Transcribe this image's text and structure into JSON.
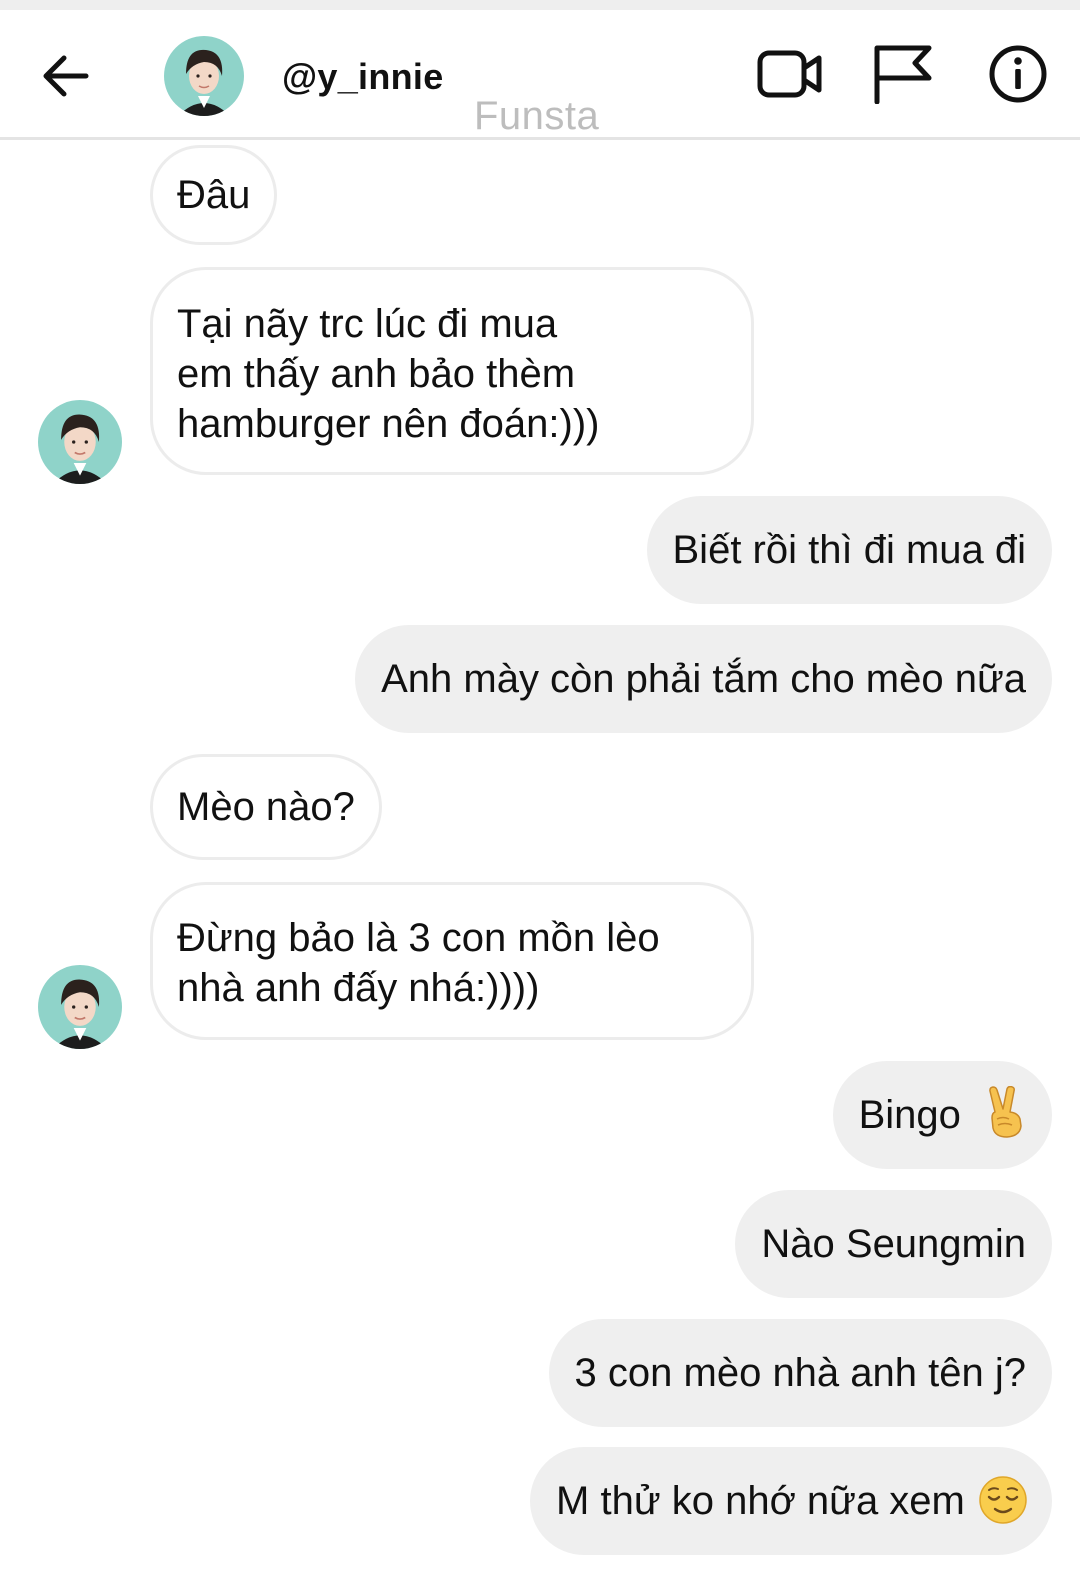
{
  "header": {
    "username": "@y_innie",
    "watermark": "Funsta",
    "icons": {
      "back": "arrow-left-icon",
      "video": "video-camera-icon",
      "flag": "flag-icon",
      "info": "info-icon"
    }
  },
  "messages": [
    {
      "direction": "incoming",
      "lines": [
        "Đâu"
      ]
    },
    {
      "direction": "incoming",
      "lines": [
        "Tại nãy trc lúc đi mua",
        "em thấy anh bảo thèm",
        "hamburger nên đoán:)))"
      ],
      "avatar": true
    },
    {
      "direction": "outgoing",
      "lines": [
        "Biết rồi thì đi mua đi"
      ]
    },
    {
      "direction": "outgoing",
      "lines": [
        "Anh mày còn phải tắm cho mèo nữa"
      ]
    },
    {
      "direction": "incoming",
      "lines": [
        "Mèo nào?"
      ]
    },
    {
      "direction": "incoming",
      "lines": [
        "Đừng bảo là 3 con mồn lèo",
        "nhà anh đấy nhá:))))"
      ],
      "avatar": true
    },
    {
      "direction": "outgoing",
      "lines": [
        "Bingo"
      ],
      "emoji": "victory-hand-emoji"
    },
    {
      "direction": "outgoing",
      "lines": [
        "Nào Seungmin"
      ]
    },
    {
      "direction": "outgoing",
      "lines": [
        "3 con mèo nhà anh tên j?"
      ]
    },
    {
      "direction": "outgoing",
      "lines": [
        "M thử ko nhớ nữa xem"
      ],
      "emoji": "relieved-face-emoji"
    }
  ],
  "colors": {
    "outgoing_bubble": "#efefef",
    "incoming_border": "#ececec",
    "avatar_bg": "#8fd3c9",
    "watermark": "#bdbdbd"
  }
}
